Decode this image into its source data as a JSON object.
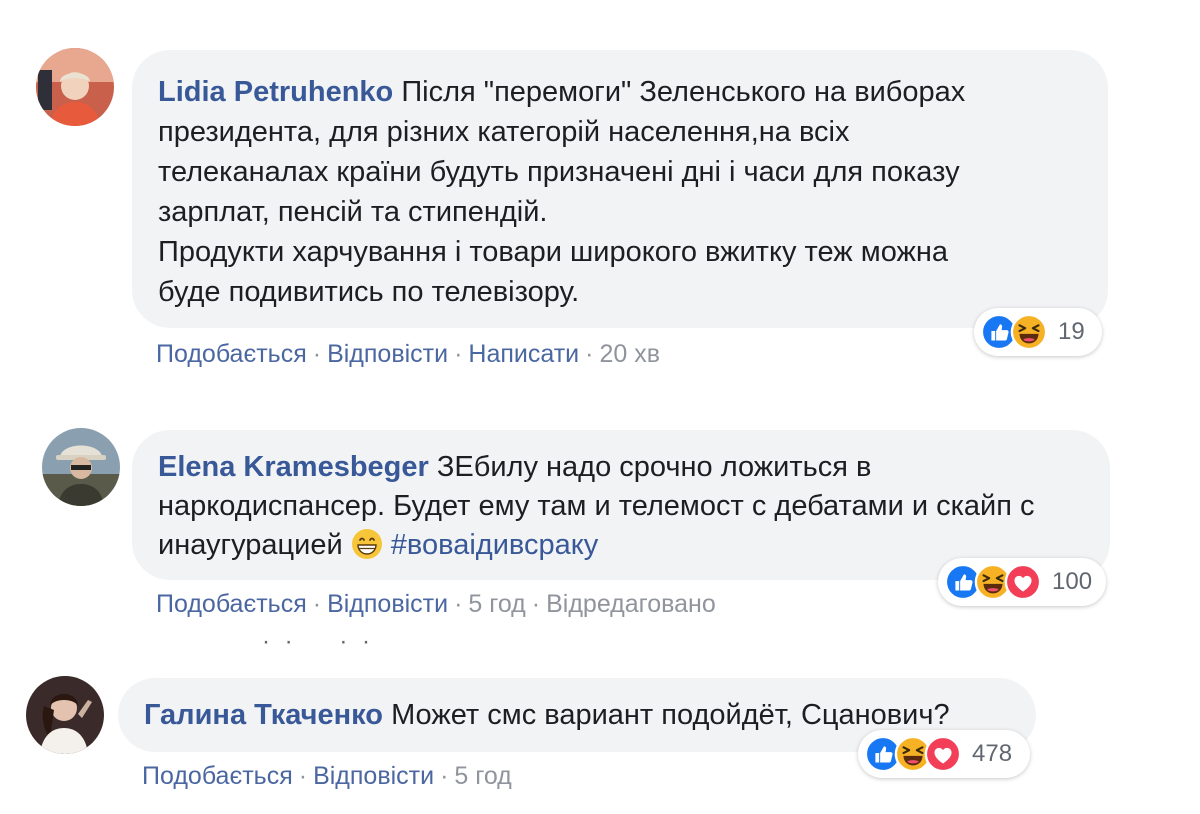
{
  "comments": [
    {
      "author": "Lidia Petruhenko",
      "lines": [
        "Після \"перемоги\" Зеленського на виборах",
        "президента, для різних категорій населення,на всіх",
        "телеканалах країни будуть призначені дні і часи для показу",
        "зарплат, пенсій та стипендій.",
        "Продукти харчування і товари широкого вжитку теж можна",
        "буде подивитись по телевізору."
      ],
      "actions": {
        "like": "Подобається",
        "reply": "Відповісти",
        "message": "Написати",
        "time": "20 хв"
      },
      "reactions": {
        "icons": [
          "like-icon",
          "haha-icon"
        ],
        "count": "19"
      }
    },
    {
      "author": "Elena Kramesbeger",
      "lines": [
        "ЗЕбилу надо срочно ложиться в",
        "наркодиспансер. Будет ему там и телемост с дебатами и скайп с",
        "инаугурацией"
      ],
      "hashtag": "#воваідивсраку",
      "emoji": "grinning-emoji",
      "actions": {
        "like": "Подобається",
        "reply": "Відповісти",
        "time": "5 год",
        "edited": "Відредаговано"
      },
      "reactions": {
        "icons": [
          "like-icon",
          "haha-icon",
          "love-icon"
        ],
        "count": "100"
      }
    },
    {
      "author": "Галина Ткаченко",
      "lines": [
        "Может смс вариант подойдёт, Сцанович?"
      ],
      "actions": {
        "like": "Подобається",
        "reply": "Відповісти",
        "time": "5 год"
      },
      "reactions": {
        "icons": [
          "like-icon",
          "haha-icon",
          "love-icon"
        ],
        "count": "478"
      }
    }
  ],
  "colors": {
    "bubble": "#f2f3f5",
    "author": "#385898",
    "action_link": "#4b67a1",
    "meta": "#90949c",
    "like": "#1877f2",
    "haha": "#f7b125",
    "love": "#f33e58"
  }
}
